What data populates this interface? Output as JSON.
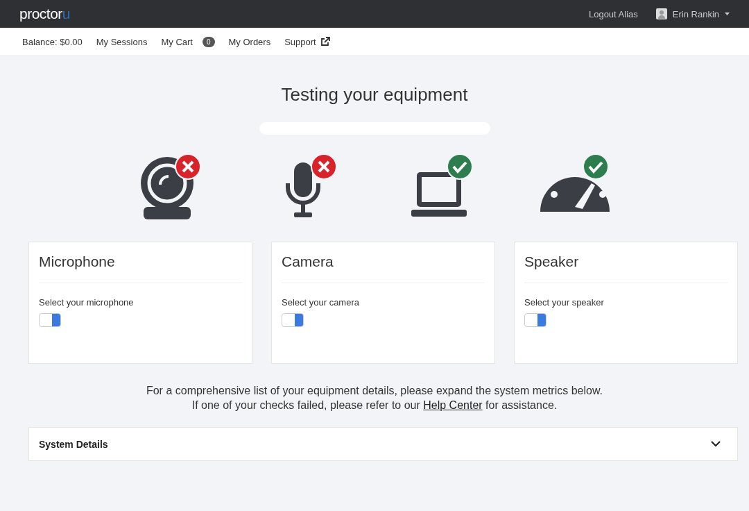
{
  "header": {
    "logo": {
      "main": "proctor",
      "accent": "u"
    },
    "logout": "Logout Alias",
    "user": "Erin Rankin"
  },
  "subnav": {
    "balance": "Balance: $0.00",
    "items": [
      {
        "kind": "link",
        "label": "My Sessions"
      },
      {
        "kind": "cart",
        "label": "My Cart",
        "badge": "0"
      },
      {
        "kind": "link",
        "label": "My Orders"
      },
      {
        "kind": "external",
        "label": "Support"
      }
    ]
  },
  "title": "Testing your equipment",
  "checks": [
    {
      "kind": "camera",
      "passed": false
    },
    {
      "kind": "microphone",
      "passed": false
    },
    {
      "kind": "laptop",
      "passed": true
    },
    {
      "kind": "speed",
      "passed": true
    }
  ],
  "cards": [
    {
      "title": "Microphone",
      "label": "Select your microphone"
    },
    {
      "title": "Camera",
      "label": "Select your camera"
    },
    {
      "title": "Speaker",
      "label": "Select your speaker"
    }
  ],
  "info": {
    "line1": "For a comprehensive list of your equipment details, please expand the system metrics below.",
    "line2_before": "If one of your checks failed, please refer to our",
    "link": "Help Center",
    "line2_after": "for assistance."
  },
  "details": {
    "title": "System Details",
    "expanded": false
  }
}
